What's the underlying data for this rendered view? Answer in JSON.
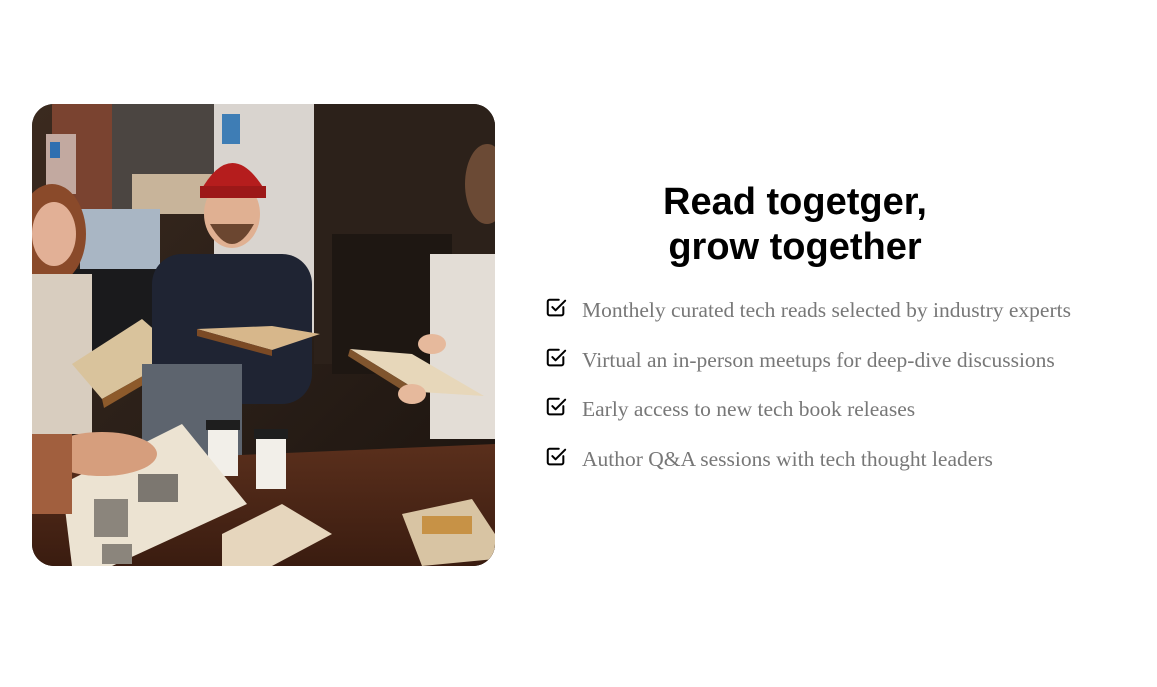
{
  "heading": {
    "line1": "Read togetger,",
    "line2": "grow together"
  },
  "image": {
    "alt": "Group of people reading books together at a cafe"
  },
  "features": [
    {
      "icon": "checkbox-check-icon",
      "text": "Monthely curated tech reads selected by industry experts"
    },
    {
      "icon": "checkbox-check-icon",
      "text": "Virtual an in-person meetups for deep-dive discussions"
    },
    {
      "icon": "checkbox-check-icon",
      "text": "Early access to new tech book releases"
    },
    {
      "icon": "checkbox-check-icon",
      "text": "Author Q&A sessions with tech thought leaders"
    }
  ]
}
